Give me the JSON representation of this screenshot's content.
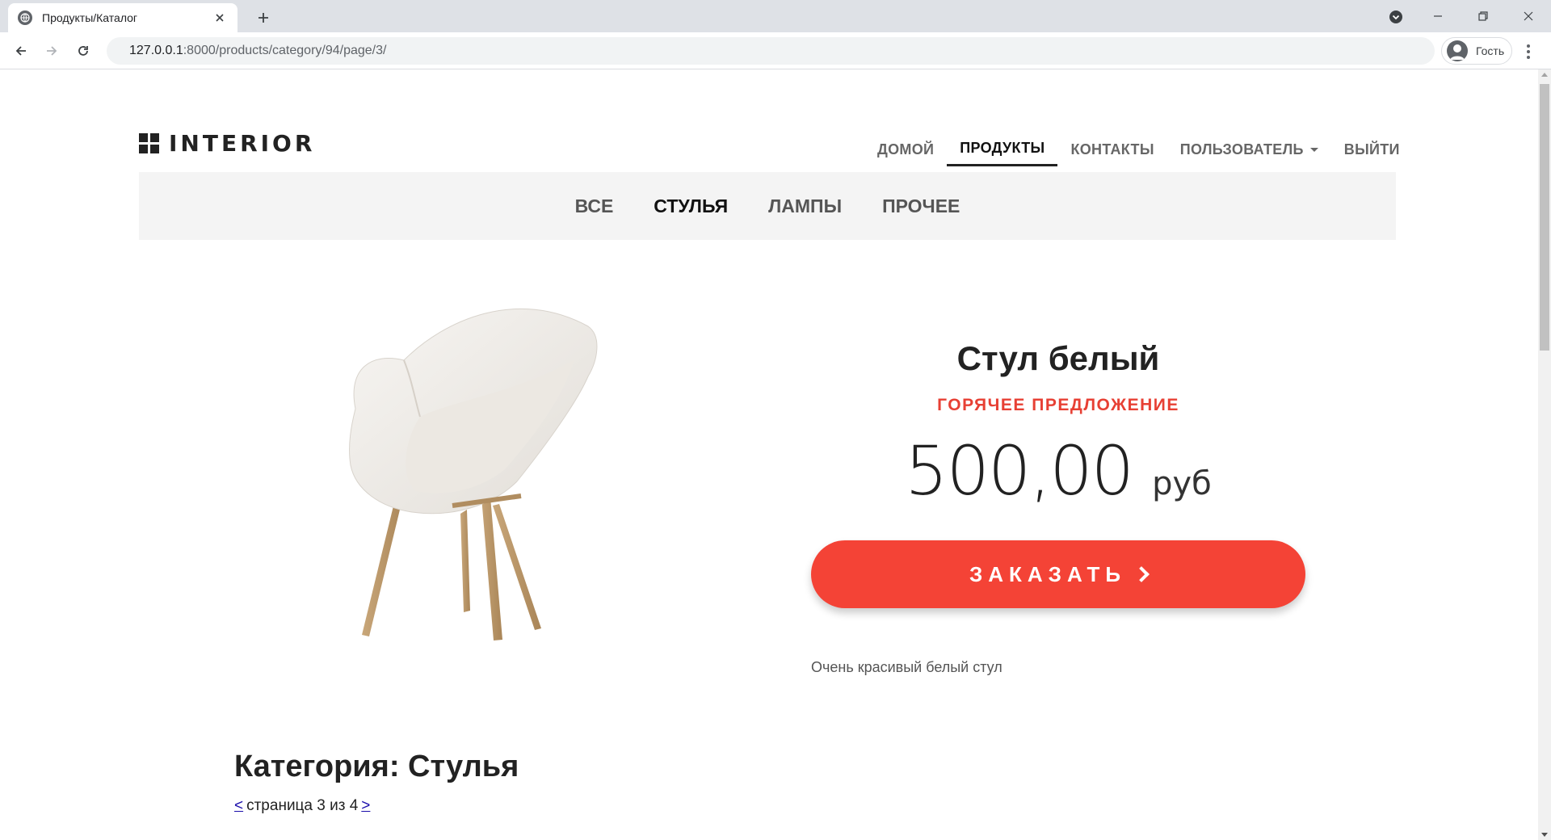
{
  "browser": {
    "tab_title": "Продукты/Каталог",
    "url_host": "127.0.0.1",
    "url_path": ":8000/products/category/94/page/3/",
    "profile_label": "Гость"
  },
  "site": {
    "logo_text": "INTERIOR",
    "nav": [
      {
        "label": "ДОМОЙ",
        "active": false
      },
      {
        "label": "ПРОДУКТЫ",
        "active": true
      },
      {
        "label": "КОНТАКТЫ",
        "active": false
      },
      {
        "label": "ПОЛЬЗОВАТЕЛЬ",
        "active": false,
        "dropdown": true
      },
      {
        "label": "ВЫЙТИ",
        "active": false
      }
    ],
    "categories": [
      {
        "label": "ВСЕ",
        "active": false
      },
      {
        "label": "СТУЛЬЯ",
        "active": true
      },
      {
        "label": "ЛАМПЫ",
        "active": false
      },
      {
        "label": "ПРОЧЕЕ",
        "active": false
      }
    ]
  },
  "product": {
    "name": "Стул белый",
    "badge": "ГОРЯЧЕЕ ПРЕДЛОЖЕНИЕ",
    "price": "500,00",
    "currency": "руб",
    "order_label": "ЗАКАЗАТЬ",
    "description": "Очень красивый белый стул"
  },
  "category": {
    "title": "Категория: Стулья",
    "prev": "< ",
    "page_text": "страница 3 из 4",
    "next": ">"
  },
  "colors": {
    "accent": "#f44336",
    "badge": "#e74034",
    "catbar_bg": "#f4f4f4"
  }
}
